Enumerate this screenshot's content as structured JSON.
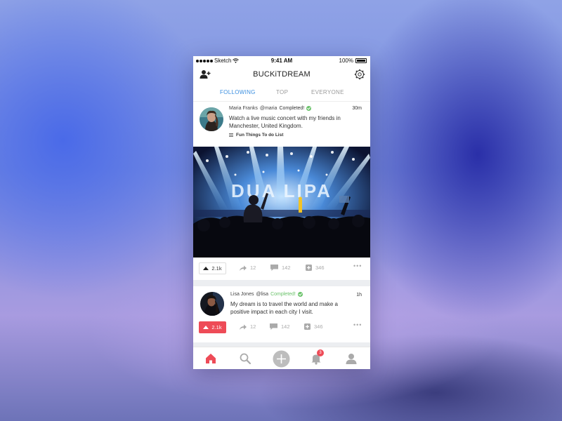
{
  "status_bar": {
    "carrier": "Sketch",
    "time": "9:41 AM",
    "battery": "100%"
  },
  "header": {
    "title": "BUCKiTDREAM"
  },
  "tabs": [
    {
      "label": "FOLLOWING",
      "active": true
    },
    {
      "label": "TOP",
      "active": false
    },
    {
      "label": "EVERYONE",
      "active": false
    }
  ],
  "posts": [
    {
      "author": "Maria Franks",
      "handle": "@maria",
      "status": "Completed!",
      "time": "30m",
      "text": "Watch a live music concert with my friends in Manchester, United Kingdom.",
      "list": "Fun Things To do List",
      "upvotes": "2.1k",
      "shares": "12",
      "comments": "142",
      "adds": "346",
      "image_text": "DUA LIPA"
    },
    {
      "author": "Lisa Jones",
      "handle": "@lisa",
      "status": "Completed!",
      "time": "1h",
      "text": "My dream is to travel the world and make a positive impact in each city I visit.",
      "upvotes": "2.1k",
      "shares": "12",
      "comments": "142",
      "adds": "346"
    }
  ],
  "notifications_badge": "3",
  "colors": {
    "accent": "#3b8fe0",
    "upvote_active": "#ee4b57",
    "completed": "#6ac26a"
  }
}
